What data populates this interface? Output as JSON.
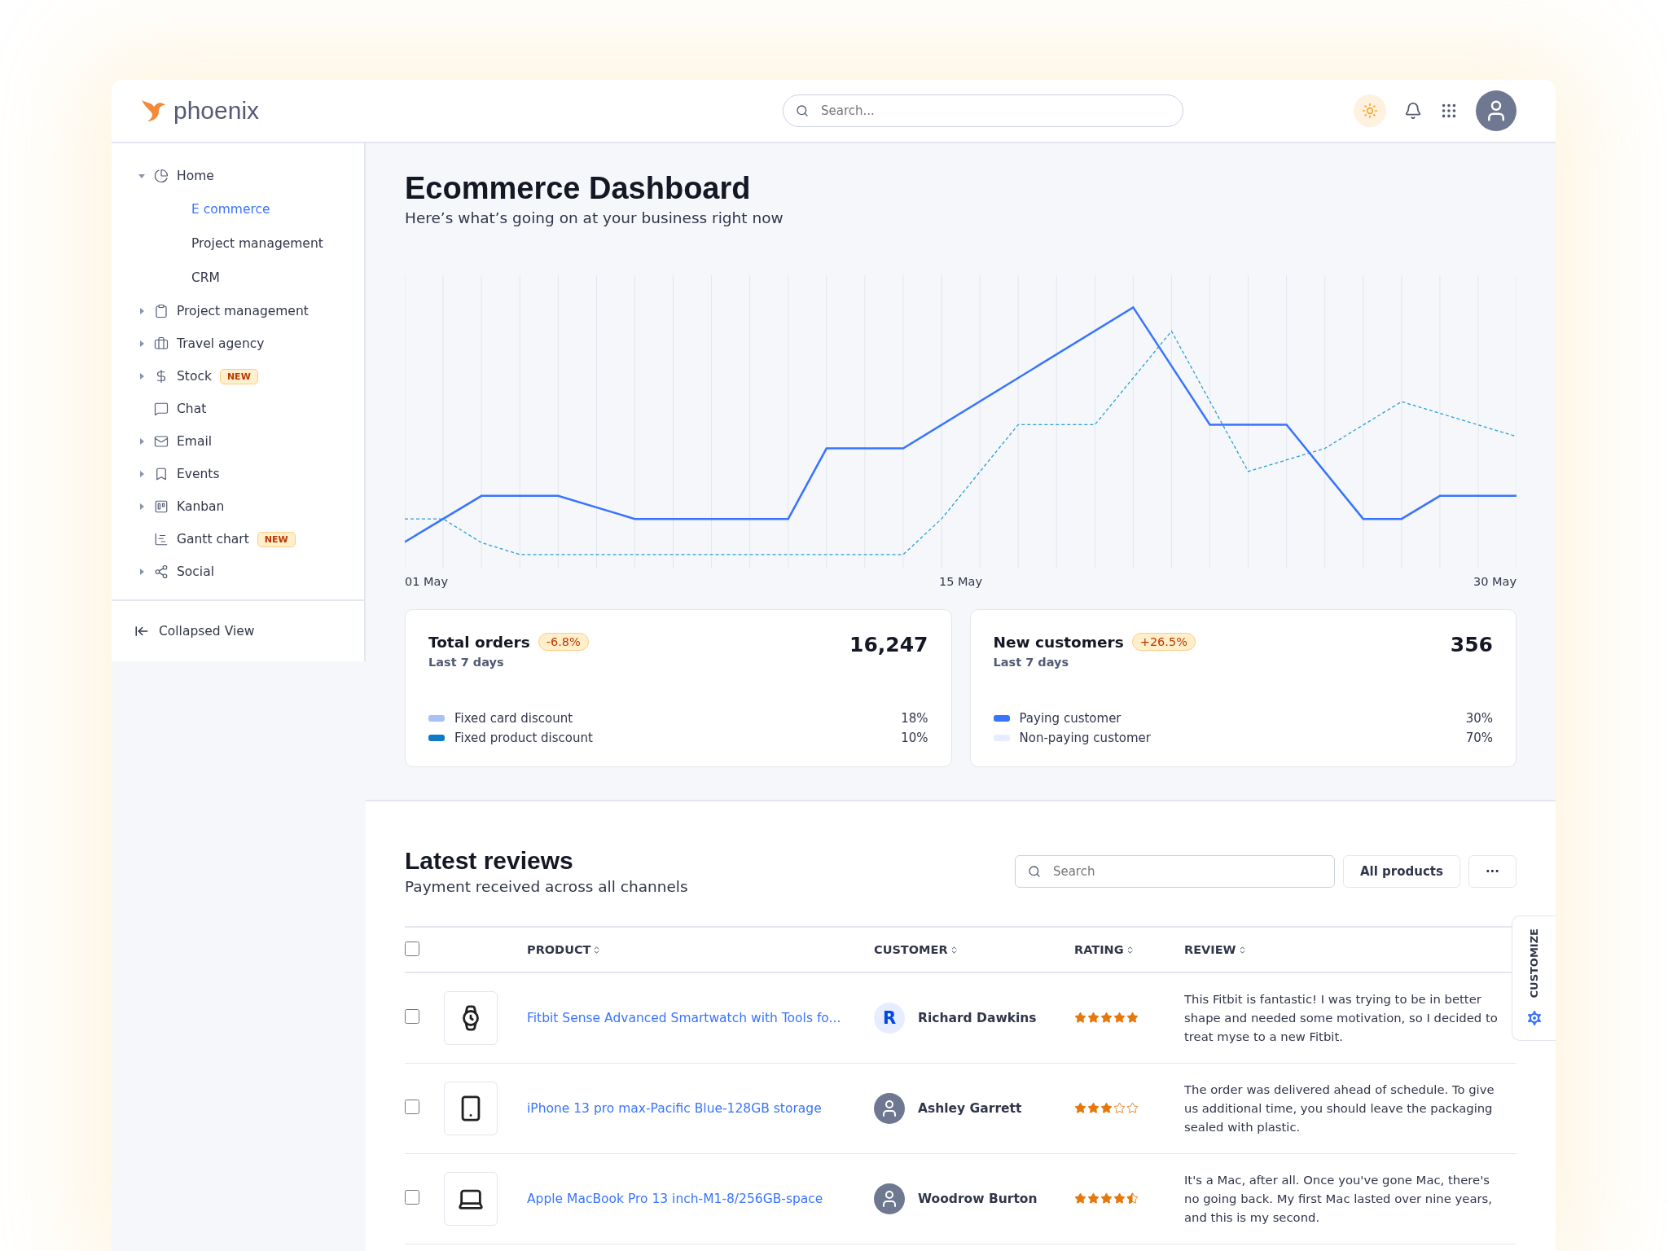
{
  "header": {
    "logo": "phoenix",
    "search": {
      "placeholder": "Search..."
    }
  },
  "sidebar": {
    "items": [
      {
        "label": "Home",
        "expandable": true,
        "expanded": true,
        "children": [
          {
            "label": "E commerce",
            "selected": true
          },
          {
            "label": "Project management",
            "selected": false
          },
          {
            "label": "CRM",
            "selected": false
          }
        ]
      },
      {
        "label": "Project management",
        "expandable": true,
        "expanded": false
      },
      {
        "label": "Travel agency",
        "expandable": true,
        "expanded": false
      },
      {
        "label": "Stock",
        "expandable": true,
        "expanded": false,
        "badge": "NEW"
      },
      {
        "label": "Chat",
        "expandable": false
      },
      {
        "label": "Email",
        "expandable": true,
        "expanded": false
      },
      {
        "label": "Events",
        "expandable": true,
        "expanded": false
      },
      {
        "label": "Kanban",
        "expandable": true,
        "expanded": false
      },
      {
        "label": "Gantt chart",
        "expandable": false,
        "badge": "NEW"
      },
      {
        "label": "Social",
        "expandable": true,
        "expanded": false
      }
    ],
    "footer": "Collapsed View"
  },
  "dashboard": {
    "title": "Ecommerce Dashboard",
    "subtitle": "Here’s what’s going on at your business right now",
    "chart": {
      "xlabels": [
        "01 May",
        "15 May",
        "30 May"
      ]
    }
  },
  "stats": [
    {
      "title": "Total orders",
      "change": "-6.8%",
      "period": "Last 7 days",
      "value": "16,247",
      "legend": [
        {
          "label": "Fixed card discount",
          "value": "18%",
          "color": "#a9c1f7"
        },
        {
          "label": "Fixed product discount",
          "value": "10%",
          "color": "#0c7ac7"
        }
      ]
    },
    {
      "title": "New customers",
      "change": "+26.5%",
      "period": "Last 7 days",
      "value": "356",
      "legend": [
        {
          "label": "Paying customer",
          "value": "30%",
          "color": "#3874ff"
        },
        {
          "label": "Non-paying customer",
          "value": "70%",
          "color": "#e5edff"
        }
      ]
    }
  ],
  "reviews": {
    "title": "Latest reviews",
    "subtitle": "Payment received across all channels",
    "search": {
      "placeholder": "Search"
    },
    "filter": "All products",
    "more": "···",
    "columns": [
      "PRODUCT",
      "CUSTOMER",
      "RATING",
      "REVIEW"
    ],
    "all_checked": false,
    "rows": [
      {
        "checked": false,
        "product": "Fitbit Sense Advanced Smartwatch with Tools fo...",
        "initial": "R",
        "customer": "Richard Dawkins",
        "stars": 5,
        "review": "This Fitbit is fantastic! I was trying to be in better shape and needed some motivation, so I decided to treat myse to a new Fitbit."
      },
      {
        "checked": false,
        "product": "iPhone 13 pro max-Pacific Blue-128GB storage",
        "customer": "Ashley Garrett",
        "stars": 3,
        "review": "The order was delivered ahead of schedule. To give us additional time, you should leave the packaging sealed with plastic."
      },
      {
        "checked": false,
        "product": "Apple MacBook Pro 13 inch-M1-8/256GB-space",
        "customer": "Woodrow Burton",
        "stars": 4.5,
        "review": "It's a Mac, after all. Once you've gone Mac, there's no going back. My first Mac lasted over nine years, and this is my second."
      }
    ]
  },
  "customize": "CUSTOMIZE"
}
